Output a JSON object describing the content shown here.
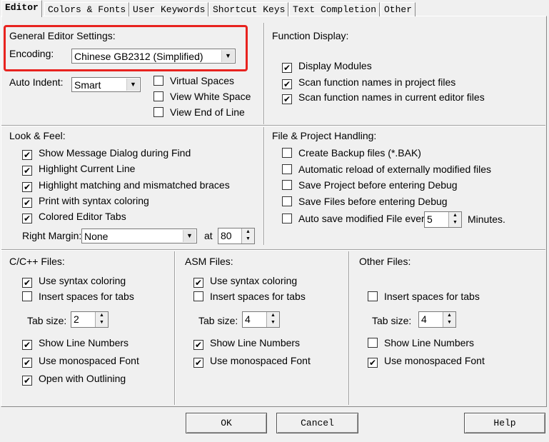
{
  "tabs": [
    "Editor",
    "Colors & Fonts",
    "User Keywords",
    "Shortcut Keys",
    "Text Completion",
    "Other"
  ],
  "general": {
    "title": "General Editor Settings:",
    "encoding_label": "Encoding:",
    "encoding_value": "Chinese GB2312 (Simplified)",
    "auto_indent_label": "Auto Indent:",
    "auto_indent_value": "Smart",
    "options": [
      {
        "label": "Virtual Spaces",
        "checked": false
      },
      {
        "label": "View White Space",
        "checked": false
      },
      {
        "label": "View End of Line",
        "checked": false
      }
    ]
  },
  "function_display": {
    "title": "Function Display:",
    "options": [
      {
        "label": "Display Modules",
        "checked": true
      },
      {
        "label": "Scan function names in project files",
        "checked": true
      },
      {
        "label": "Scan function names in current editor files",
        "checked": true
      }
    ]
  },
  "look_feel": {
    "title": "Look & Feel:",
    "options": [
      {
        "label": "Show Message Dialog during Find",
        "checked": true
      },
      {
        "label": "Highlight Current Line",
        "checked": true
      },
      {
        "label": "Highlight matching and mismatched braces",
        "checked": true
      },
      {
        "label": "Print with syntax coloring",
        "checked": true
      },
      {
        "label": "Colored Editor Tabs",
        "checked": true
      }
    ],
    "right_margin_label": "Right Margin:",
    "right_margin_value": "None",
    "at_label": "at",
    "at_value": "80"
  },
  "file_project": {
    "title": "File & Project Handling:",
    "options": [
      {
        "label": "Create Backup files (*.BAK)",
        "checked": false
      },
      {
        "label": "Automatic reload of externally modified files",
        "checked": false
      },
      {
        "label": "Save Project before entering Debug",
        "checked": false
      },
      {
        "label": "Save Files before entering Debug",
        "checked": false
      },
      {
        "label": "Auto save modified File every",
        "checked": false
      }
    ],
    "autosave_value": "5",
    "minutes_label": "Minutes."
  },
  "cfiles": {
    "title": "C/C++ Files:",
    "syntax": {
      "label": "Use syntax coloring",
      "checked": true
    },
    "spaces": {
      "label": "Insert spaces for tabs",
      "checked": false
    },
    "tab_size_label": "Tab size:",
    "tab_size": "2",
    "line_numbers": {
      "label": "Show Line Numbers",
      "checked": true
    },
    "mono": {
      "label": "Use monospaced Font",
      "checked": true
    },
    "outlining": {
      "label": "Open with Outlining",
      "checked": true
    }
  },
  "asmfiles": {
    "title": "ASM Files:",
    "syntax": {
      "label": "Use syntax coloring",
      "checked": true
    },
    "spaces": {
      "label": "Insert spaces for tabs",
      "checked": false
    },
    "tab_size_label": "Tab size:",
    "tab_size": "4",
    "line_numbers": {
      "label": "Show Line Numbers",
      "checked": true
    },
    "mono": {
      "label": "Use monospaced Font",
      "checked": true
    }
  },
  "otherfiles": {
    "title": "Other Files:",
    "spaces": {
      "label": "Insert spaces for tabs",
      "checked": false
    },
    "tab_size_label": "Tab size:",
    "tab_size": "4",
    "line_numbers": {
      "label": "Show Line Numbers",
      "checked": false
    },
    "mono": {
      "label": "Use monospaced Font",
      "checked": true
    }
  },
  "buttons": {
    "ok": "OK",
    "cancel": "Cancel",
    "help": "Help"
  },
  "colors": {
    "highlight_box": "#e8231f",
    "background": "#f0f0f0"
  }
}
